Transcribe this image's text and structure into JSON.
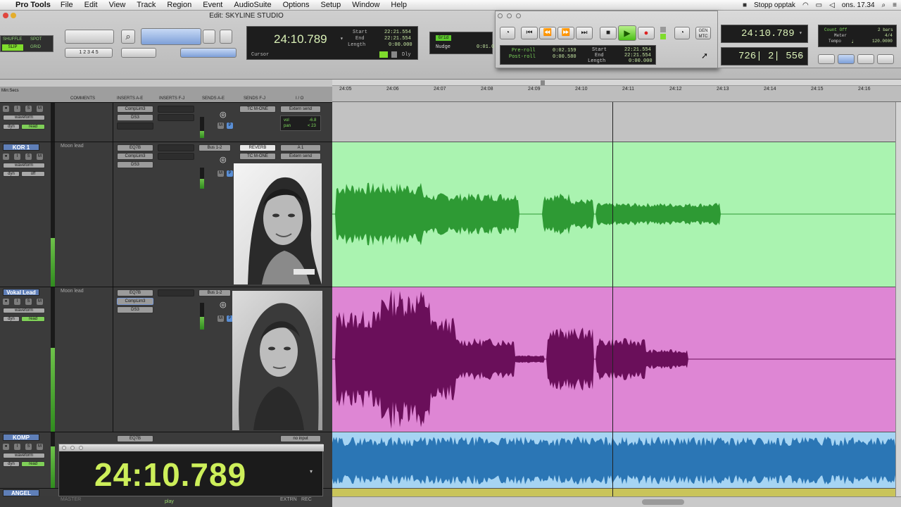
{
  "menubar": {
    "app": "Pro Tools",
    "items": [
      "File",
      "Edit",
      "View",
      "Track",
      "Region",
      "Event",
      "AudioSuite",
      "Options",
      "Setup",
      "Window",
      "Help"
    ],
    "status": "Stopp opptak",
    "clock": "ons. 17.34"
  },
  "window": {
    "title": "Edit: SKYLINE STUDIO"
  },
  "modes": {
    "shuffle": "SHUFFLE",
    "spot": "SPOT",
    "slip": "SLIP",
    "grid": "GRID"
  },
  "counter": {
    "main": "24:10.789",
    "start_label": "Start",
    "end_label": "End",
    "length_label": "Length",
    "start": "22:21.554",
    "end": "22:21.554",
    "length": "0:00.000",
    "cursor_label": "Cursor",
    "dly_label": "Dly"
  },
  "grid": {
    "grid_label": "Grid",
    "nudge_label": "Nudge",
    "nudge_value": "0:01.0"
  },
  "transport": {
    "preroll_label": "Pre-roll",
    "postroll_label": "Post-roll",
    "preroll": "0:02.159",
    "postroll": "0:00.580",
    "start_label": "Start",
    "end_label": "End",
    "length_label": "Length",
    "start": "22:21.554",
    "end": "22:21.554",
    "length": "0:00.000",
    "gen_mtc": "GEN MTC",
    "main_counter": "24:10.789",
    "sub_counter": "726| 2| 556",
    "count_off": "Count Off",
    "meter": "Meter",
    "tempo": "Tempo",
    "bars": "2 bars",
    "meter_value": "4/4",
    "tempo_value": "120.0000"
  },
  "ruler": {
    "label": "Min:Secs",
    "ticks": [
      "24:05",
      "24:06",
      "24:07",
      "24:08",
      "24:09",
      "24:10",
      "24:11",
      "24:12",
      "24:13",
      "24:14",
      "24:15",
      "24:16"
    ]
  },
  "columns": {
    "comments": "COMMENTS",
    "inserts_ae": "INSERTS A-E",
    "inserts_fj": "INSERTS F-J",
    "sends_ae": "SENDS A-E",
    "sends_fj": "SENDS F-J",
    "io": "I / O"
  },
  "tracks": [
    {
      "name": "",
      "view": "waveform",
      "auto": "read",
      "dyn": "dyn",
      "comment": "",
      "inserts": [
        "CompLim3",
        "DS3"
      ],
      "send": "",
      "sends_fj": "TC M-ONE",
      "io": "Extern send",
      "vol_label": "vol",
      "vol": "-6.8",
      "pan_label": "pan",
      "pan": "< 23"
    },
    {
      "name": "KOR 1",
      "view": "waveform",
      "auto": "off",
      "dyn": "dyn",
      "comment": "Moon lead",
      "inserts": [
        "EQ7B",
        "CompLim3",
        "DS3"
      ],
      "send": "Bus 1-2",
      "sends_fj": [
        "REVERB",
        "TC M-ONE"
      ],
      "io": [
        "A 1",
        "Extern send"
      ]
    },
    {
      "name": "Vokal Lead",
      "view": "waveform",
      "auto": "read",
      "dyn": "dyn",
      "comment": "Moon lead",
      "inserts": [
        "EQ7B",
        "CompLim3",
        "DS3"
      ],
      "send": "Bus 1-2"
    },
    {
      "name": "KOMP",
      "view": "waveform",
      "auto": "read",
      "dyn": "dyn",
      "inserts": [
        "EQ7B"
      ],
      "io": "no input"
    },
    {
      "name": "ANGEL"
    }
  ],
  "big_counter": {
    "value": "24:10.789"
  },
  "bottom": {
    "master": "MASTER",
    "play": "play",
    "extrn": "EXTRN",
    "rec": "REC"
  },
  "colors": {
    "green_lane": "#aaf3b0",
    "green_wave": "#2e9a34",
    "pink_lane": "#de86d4",
    "pink_wave": "#6a0f5a",
    "blue_lane": "#a6d4f3",
    "blue_wave": "#2b76b5",
    "counter": "#cdef5a"
  }
}
